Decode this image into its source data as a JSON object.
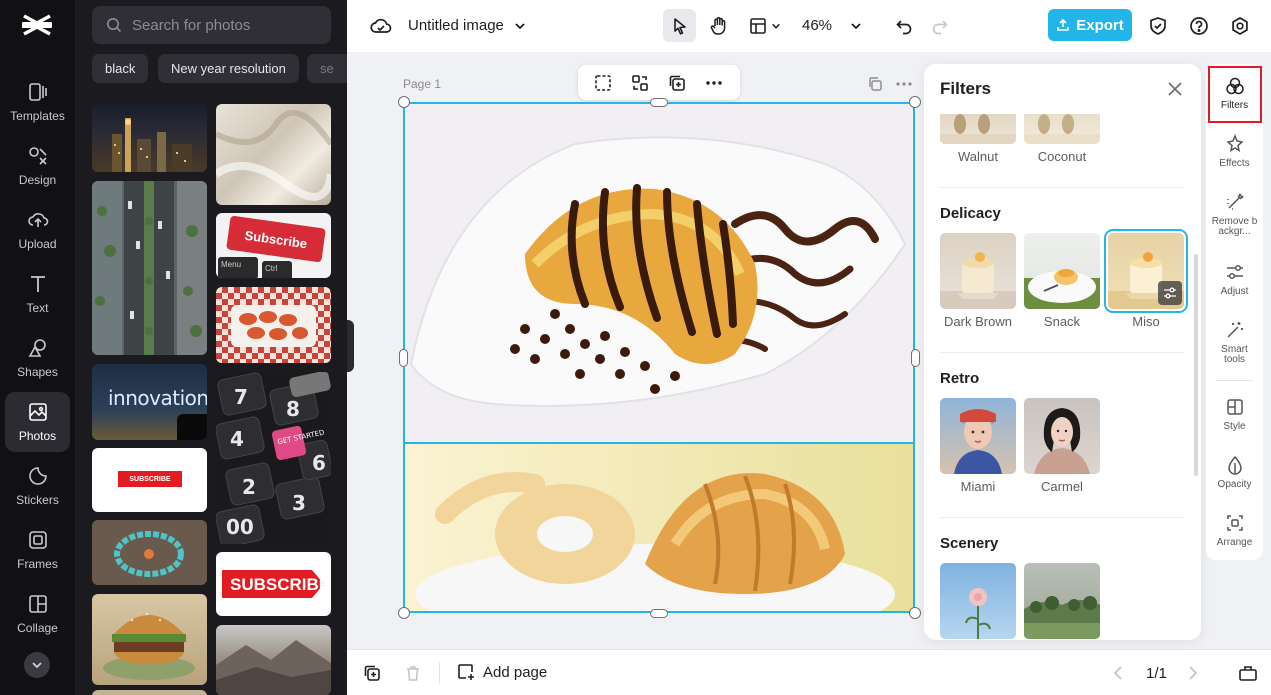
{
  "left_rail": {
    "items": [
      {
        "label": "Templates",
        "icon": "templates-icon"
      },
      {
        "label": "Design",
        "icon": "design-icon"
      },
      {
        "label": "Upload",
        "icon": "upload-icon"
      },
      {
        "label": "Text",
        "icon": "text-icon"
      },
      {
        "label": "Shapes",
        "icon": "shapes-icon"
      },
      {
        "label": "Photos",
        "icon": "photos-icon",
        "active": true
      },
      {
        "label": "Stickers",
        "icon": "stickers-icon"
      },
      {
        "label": "Frames",
        "icon": "frames-icon"
      },
      {
        "label": "Collage",
        "icon": "collage-icon"
      }
    ]
  },
  "photos_panel": {
    "search_placeholder": "Search for photos",
    "chips": [
      "black",
      "New year resolution",
      "se"
    ],
    "thumb_texts": {
      "subscribe_keyboard": "Subscribe",
      "menu": "Menu",
      "ctrl": "Ctrl",
      "innovation": "innovation",
      "get_started": "GET STARTED",
      "subscribe_banner": "SUBSCRIBE",
      "subscribe_small": "SUBSCRIBE"
    }
  },
  "topbar": {
    "title": "Untitled image",
    "zoom": "46%",
    "export_label": "Export"
  },
  "canvas": {
    "page_label": "Page 1"
  },
  "bottombar": {
    "add_page_label": "Add page",
    "page_counter": "1/1"
  },
  "filters": {
    "title": "Filters",
    "top_row": [
      "Walnut",
      "Coconut"
    ],
    "sections": [
      {
        "name": "Delicacy",
        "items": [
          "Dark Brown",
          "Snack",
          "Miso"
        ]
      },
      {
        "name": "Retro",
        "items": [
          "Miami",
          "Carmel"
        ]
      },
      {
        "name": "Scenery",
        "items": []
      }
    ]
  },
  "right_rail": {
    "items": [
      {
        "label": "Filters",
        "icon": "filters-icon",
        "active": true
      },
      {
        "label": "Effects",
        "icon": "effects-icon"
      },
      {
        "label": "Remove backgr...",
        "icon": "remove-background-icon"
      },
      {
        "label": "Adjust",
        "icon": "adjust-icon"
      },
      {
        "label": "Smart tools",
        "icon": "smart-tools-icon"
      },
      {
        "label": "Style",
        "icon": "style-icon"
      },
      {
        "label": "Opacity",
        "icon": "opacity-icon"
      },
      {
        "label": "Arrange",
        "icon": "arrange-icon"
      }
    ]
  },
  "colors": {
    "accent": "#22b5ea",
    "selection": "#23b7e5",
    "highlight_box": "#e21b23",
    "rail_bg": "#111114",
    "panel_bg": "#1b1b1f"
  }
}
